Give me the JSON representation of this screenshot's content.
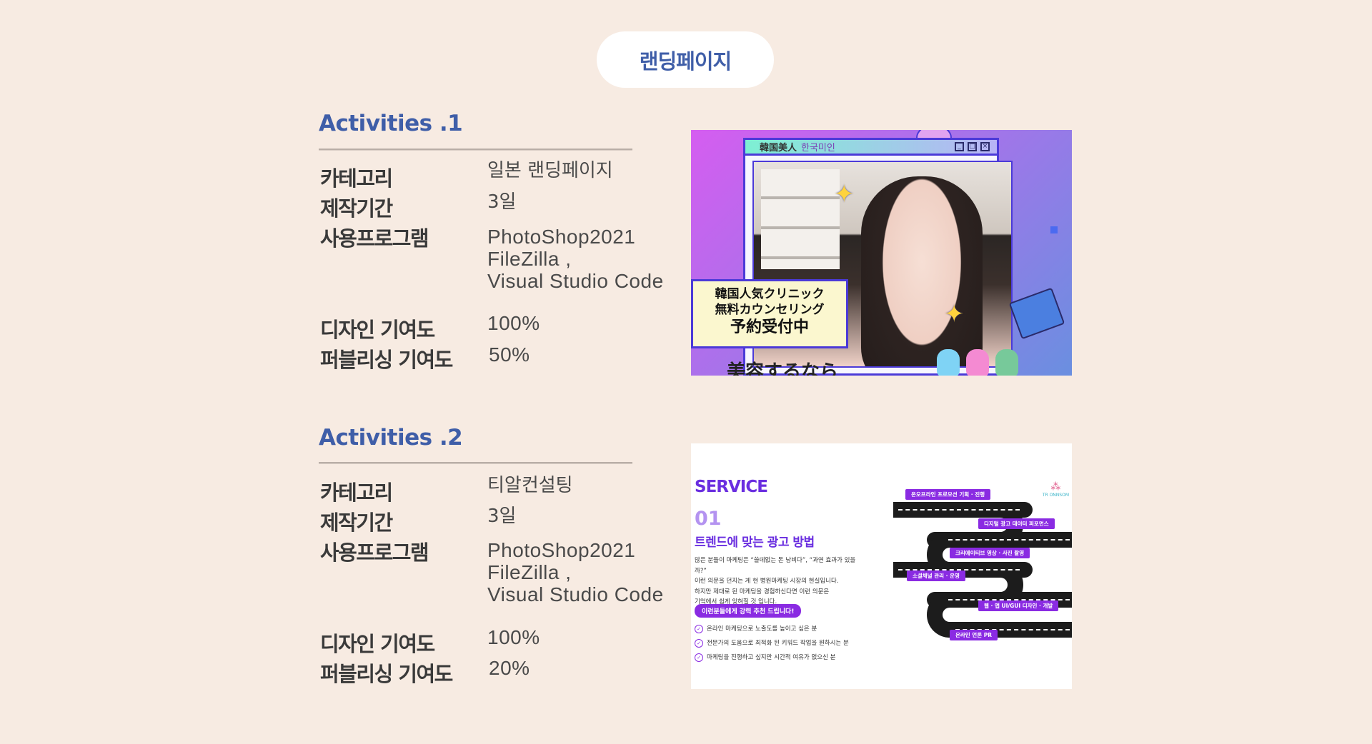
{
  "header": {
    "title": "랜딩페이지"
  },
  "activities": [
    {
      "title": "Activities .1",
      "labels": {
        "category": "카테고리",
        "period": "제작기간",
        "programs": "사용프로그램",
        "design": "디자인 기여도",
        "publishing": "퍼블리싱 기여도"
      },
      "category": "일본 랜딩페이지",
      "period": "3일",
      "programs": [
        "PhotoShop2021",
        "FileZilla ,",
        "Visual Studio Code"
      ],
      "design": "100%",
      "publishing": "50%",
      "thumb": {
        "window_title_jp": "韓国美人",
        "window_title_kr": "한국미인",
        "banner_lines": [
          "韓国人気クリニック",
          "無料カウンセリング",
          "予約受付中"
        ],
        "bottom_text": "美容するなら"
      }
    },
    {
      "title": "Activities .2",
      "labels": {
        "category": "카테고리",
        "period": "제작기간",
        "programs": "사용프로그램",
        "design": "디자인 기여도",
        "publishing": "퍼블리싱 기여도"
      },
      "category": "티알컨설팅",
      "period": "3일",
      "programs": [
        "PhotoShop2021",
        "FileZilla ,",
        "Visual Studio Code"
      ],
      "design": "100%",
      "publishing": "20%",
      "thumb": {
        "service": "SERVICE",
        "number": "01",
        "heading": "트렌드에 맞는 광고 방법",
        "paragraph": [
          "많은 분들이 마케팅은 “쓸데없는 돈 낭비다”, “과연 효과가 있을까?”",
          "이런 의문을 던지는 게 현 병원마케팅 시장의 현실입니다.",
          "하지만 제대로 된 마케팅을 경험하신다면 이런 의문은",
          "기억에서 쉽게 잊혀질 것 입니다."
        ],
        "tag": "이런분들에게 강력 추천 드립니다!",
        "checks": [
          "온라인 마케팅으로 노출도를 높이고 싶은 분",
          "전문가의 도움으로 최적화 된 키워드 작업을 원하시는 분",
          "마케팅을 진행하고 싶지만 시간적 여유가 없으신 분"
        ],
        "road_tags": [
          "온오프라인 프로모션 기획 · 진행",
          "디지털 광고 데이터 퍼포먼스",
          "크리에이티브 영상 · 사진 촬영",
          "소셜채널 관리 · 운영",
          "웹 · 앱 UI/GUI 디자인 · 개발",
          "온라인 언론 PR"
        ],
        "logo": "TR ONNSOM"
      }
    }
  ]
}
